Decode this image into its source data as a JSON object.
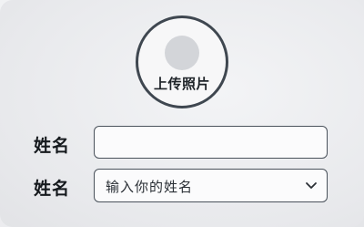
{
  "avatar": {
    "upload_label": "上传照片"
  },
  "form": {
    "name_row_1": {
      "label": "姓名",
      "value": ""
    },
    "name_row_2": {
      "label": "姓名",
      "selected_value": "输入你的姓名",
      "icon": "chevron-down-icon"
    }
  },
  "colors": {
    "border": "#4a525b",
    "avatar_border": "#3f4750",
    "placeholder_circle": "#d3d5d9",
    "text": "#15191d"
  }
}
